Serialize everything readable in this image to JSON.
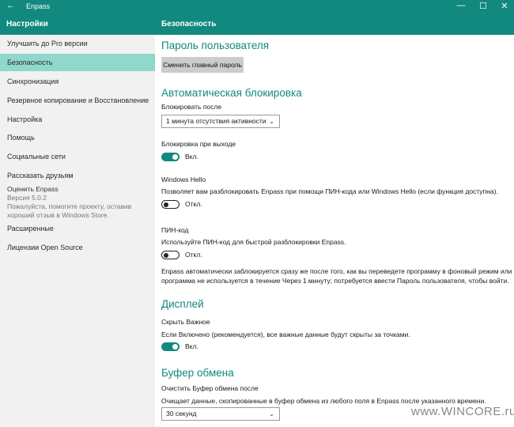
{
  "window": {
    "app_name": "Enpass",
    "back_icon": "←",
    "minimize": "—",
    "maximize": "☐",
    "close": "✕"
  },
  "header": {
    "left": "Настройки",
    "right": "Безопасность"
  },
  "sidebar": {
    "items": [
      {
        "label": "Улучшить до Pro версии"
      },
      {
        "label": "Безопасность"
      },
      {
        "label": "Синхронизация"
      },
      {
        "label": "Резервное копирование и Восстановление"
      },
      {
        "label": "Настройка"
      },
      {
        "label": "Помощь"
      },
      {
        "label": "Социальные сети"
      },
      {
        "label": "Рассказать друзьям"
      },
      {
        "label": "Расширенные"
      },
      {
        "label": "Лицензии Open Source"
      }
    ],
    "rate": {
      "title": "Оценить Enpass",
      "version": "Версия 5.0.2",
      "line1": "Пожалуйста, помогите проекту, оставив",
      "line2": "хороший отзыв в Windows Store."
    }
  },
  "main": {
    "user_password": {
      "title": "Пароль пользователя",
      "button": "Сменить главный пароль"
    },
    "autolock": {
      "title": "Автоматическая блокировка",
      "lock_after_label": "Блокировать после",
      "lock_after_value": "1 минута отсутствия активности",
      "lock_on_exit_label": "Блокировка при выходе",
      "lock_on_exit_state": "Вкл.",
      "hello_label": "Windows Hello",
      "hello_desc": "Позволяет вам разблокировать Enpass при помощи ПИН-кода или Windows Hello (если функция доступна).",
      "hello_state": "Откл.",
      "pin_label": "ПИН-код",
      "pin_desc": "Используйте ПИН-код для быстрой разблокировки Enpass.",
      "pin_state": "Откл.",
      "note_line1": "Enpass автоматически заблокируется сразу же после того, как вы переведете программу в фоновый режим или когда",
      "note_line2": "программа не используется в течение Через 1 минуту; потребуется ввести Пароль пользователя, чтобы войти."
    },
    "display": {
      "title": "Дисплей",
      "hide_label": "Скрыть Важное",
      "hide_desc": "Если Включено (рекомендуется), все важные данные будут скрыты за точками.",
      "hide_state": "Вкл."
    },
    "clipboard": {
      "title": "Буфер обмена",
      "clear_label": "Очистить Буфер обмена после",
      "clear_desc": "Очищает данные, скопированные в буфер обмена из любого поля в Enpass после указанного времени.",
      "clear_value": "30 секунд"
    }
  },
  "watermark": "www.WINCORE.ru",
  "colors": {
    "accent": "#12897e",
    "sidebar_active": "#8fd8cb",
    "sidebar_bg": "#f1f1f1"
  }
}
